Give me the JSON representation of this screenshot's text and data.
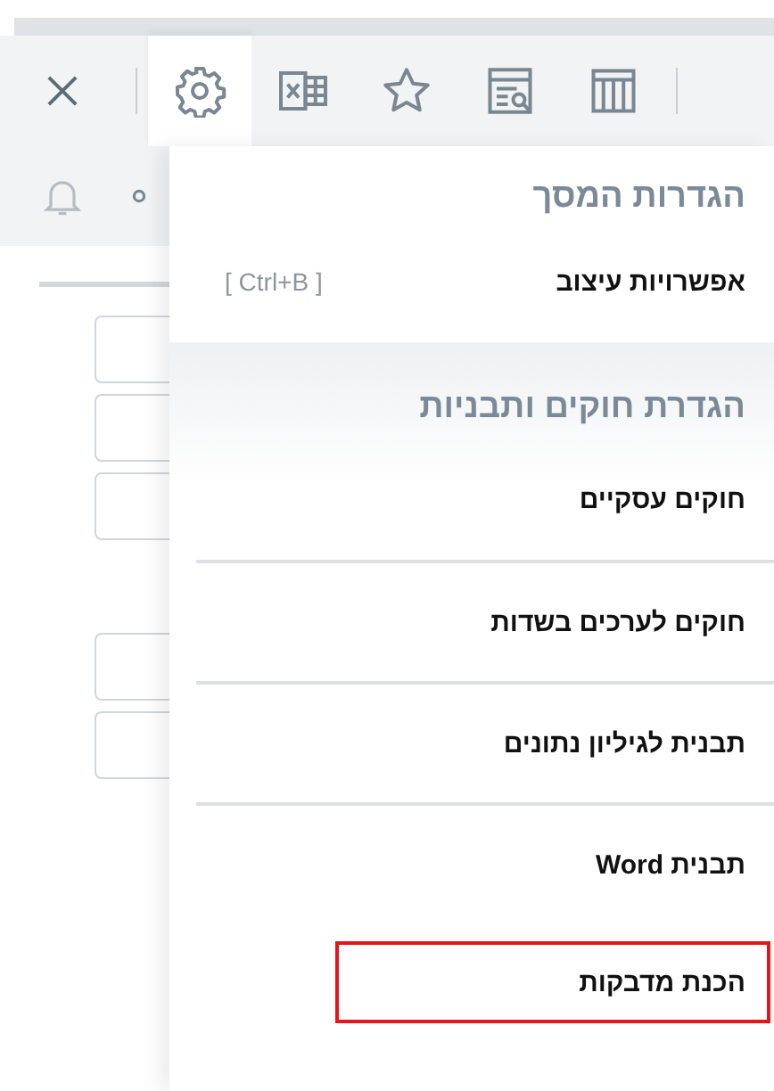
{
  "toolbar": {
    "tools": [
      {
        "kind": "settings",
        "selected": true
      },
      {
        "kind": "excel",
        "selected": false
      },
      {
        "kind": "star",
        "selected": false
      },
      {
        "kind": "report",
        "selected": false
      },
      {
        "kind": "columns",
        "selected": false
      }
    ]
  },
  "menu": {
    "sections": [
      {
        "title": "הגדרות המסך",
        "shaded": false,
        "items": [
          {
            "label": "אפשרויות עיצוב",
            "shortcut": "[ Ctrl+B ]",
            "highlighted": false
          }
        ]
      },
      {
        "title": "הגדרת חוקים ותבניות",
        "shaded": true,
        "items": [
          {
            "label": "חוקים עסקיים",
            "highlighted": false
          },
          {
            "label": "חוקים לערכים בשדות",
            "highlighted": false
          },
          {
            "label": "תבנית לגיליון נתונים",
            "highlighted": false
          },
          {
            "label": "תבנית Word",
            "highlighted": false
          },
          {
            "label": "הכנת מדבקות",
            "highlighted": true
          }
        ]
      }
    ]
  }
}
